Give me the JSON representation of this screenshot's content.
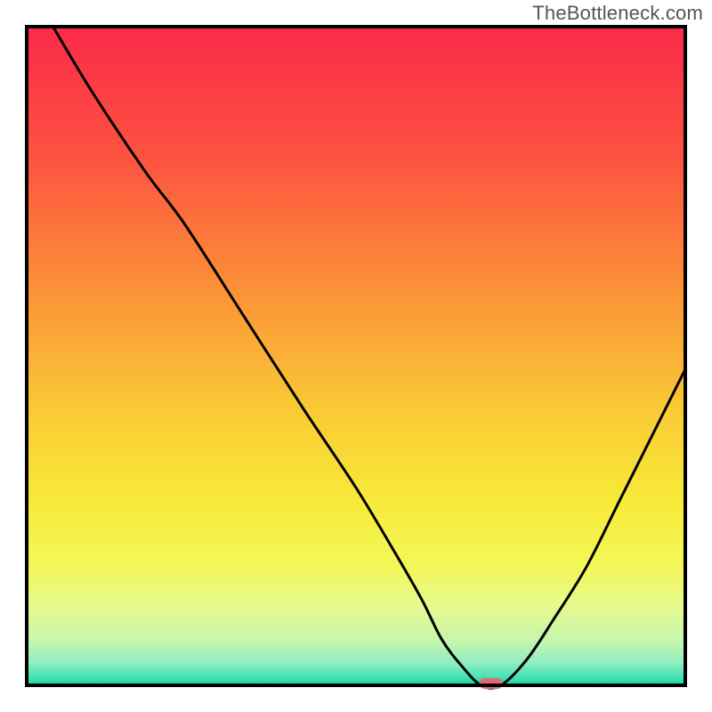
{
  "watermark": "TheBottleneck.com",
  "chart_data": {
    "type": "line",
    "title": "",
    "xlabel": "",
    "ylabel": "",
    "x_range": [
      0,
      100
    ],
    "y_range": [
      0,
      100
    ],
    "series": [
      {
        "name": "bottleneck-curve",
        "x": [
          4,
          10,
          18,
          24,
          33,
          42,
          50,
          56,
          60,
          63,
          66,
          69,
          72,
          76,
          80,
          85,
          90,
          95,
          100
        ],
        "y": [
          100,
          90,
          78,
          70,
          56,
          42,
          30,
          20,
          13,
          7,
          3,
          0,
          0,
          4,
          10,
          18,
          28,
          38,
          48
        ]
      }
    ],
    "marker": {
      "x": 70.5,
      "y": 0
    },
    "gradient_stops": [
      {
        "offset": 0.0,
        "color": "#fb2a4a"
      },
      {
        "offset": 0.2,
        "color": "#fc5340"
      },
      {
        "offset": 0.4,
        "color": "#fb9237"
      },
      {
        "offset": 0.58,
        "color": "#fac935"
      },
      {
        "offset": 0.72,
        "color": "#f7ea38"
      },
      {
        "offset": 0.82,
        "color": "#f3f858"
      },
      {
        "offset": 0.88,
        "color": "#e6f98e"
      },
      {
        "offset": 0.93,
        "color": "#c8f6ab"
      },
      {
        "offset": 0.965,
        "color": "#93eec0"
      },
      {
        "offset": 0.985,
        "color": "#4fe3b8"
      },
      {
        "offset": 1.0,
        "color": "#17d79c"
      }
    ],
    "marker_color": "#e26a6a",
    "frame_color": "#000000",
    "curve_color": "#000000"
  }
}
